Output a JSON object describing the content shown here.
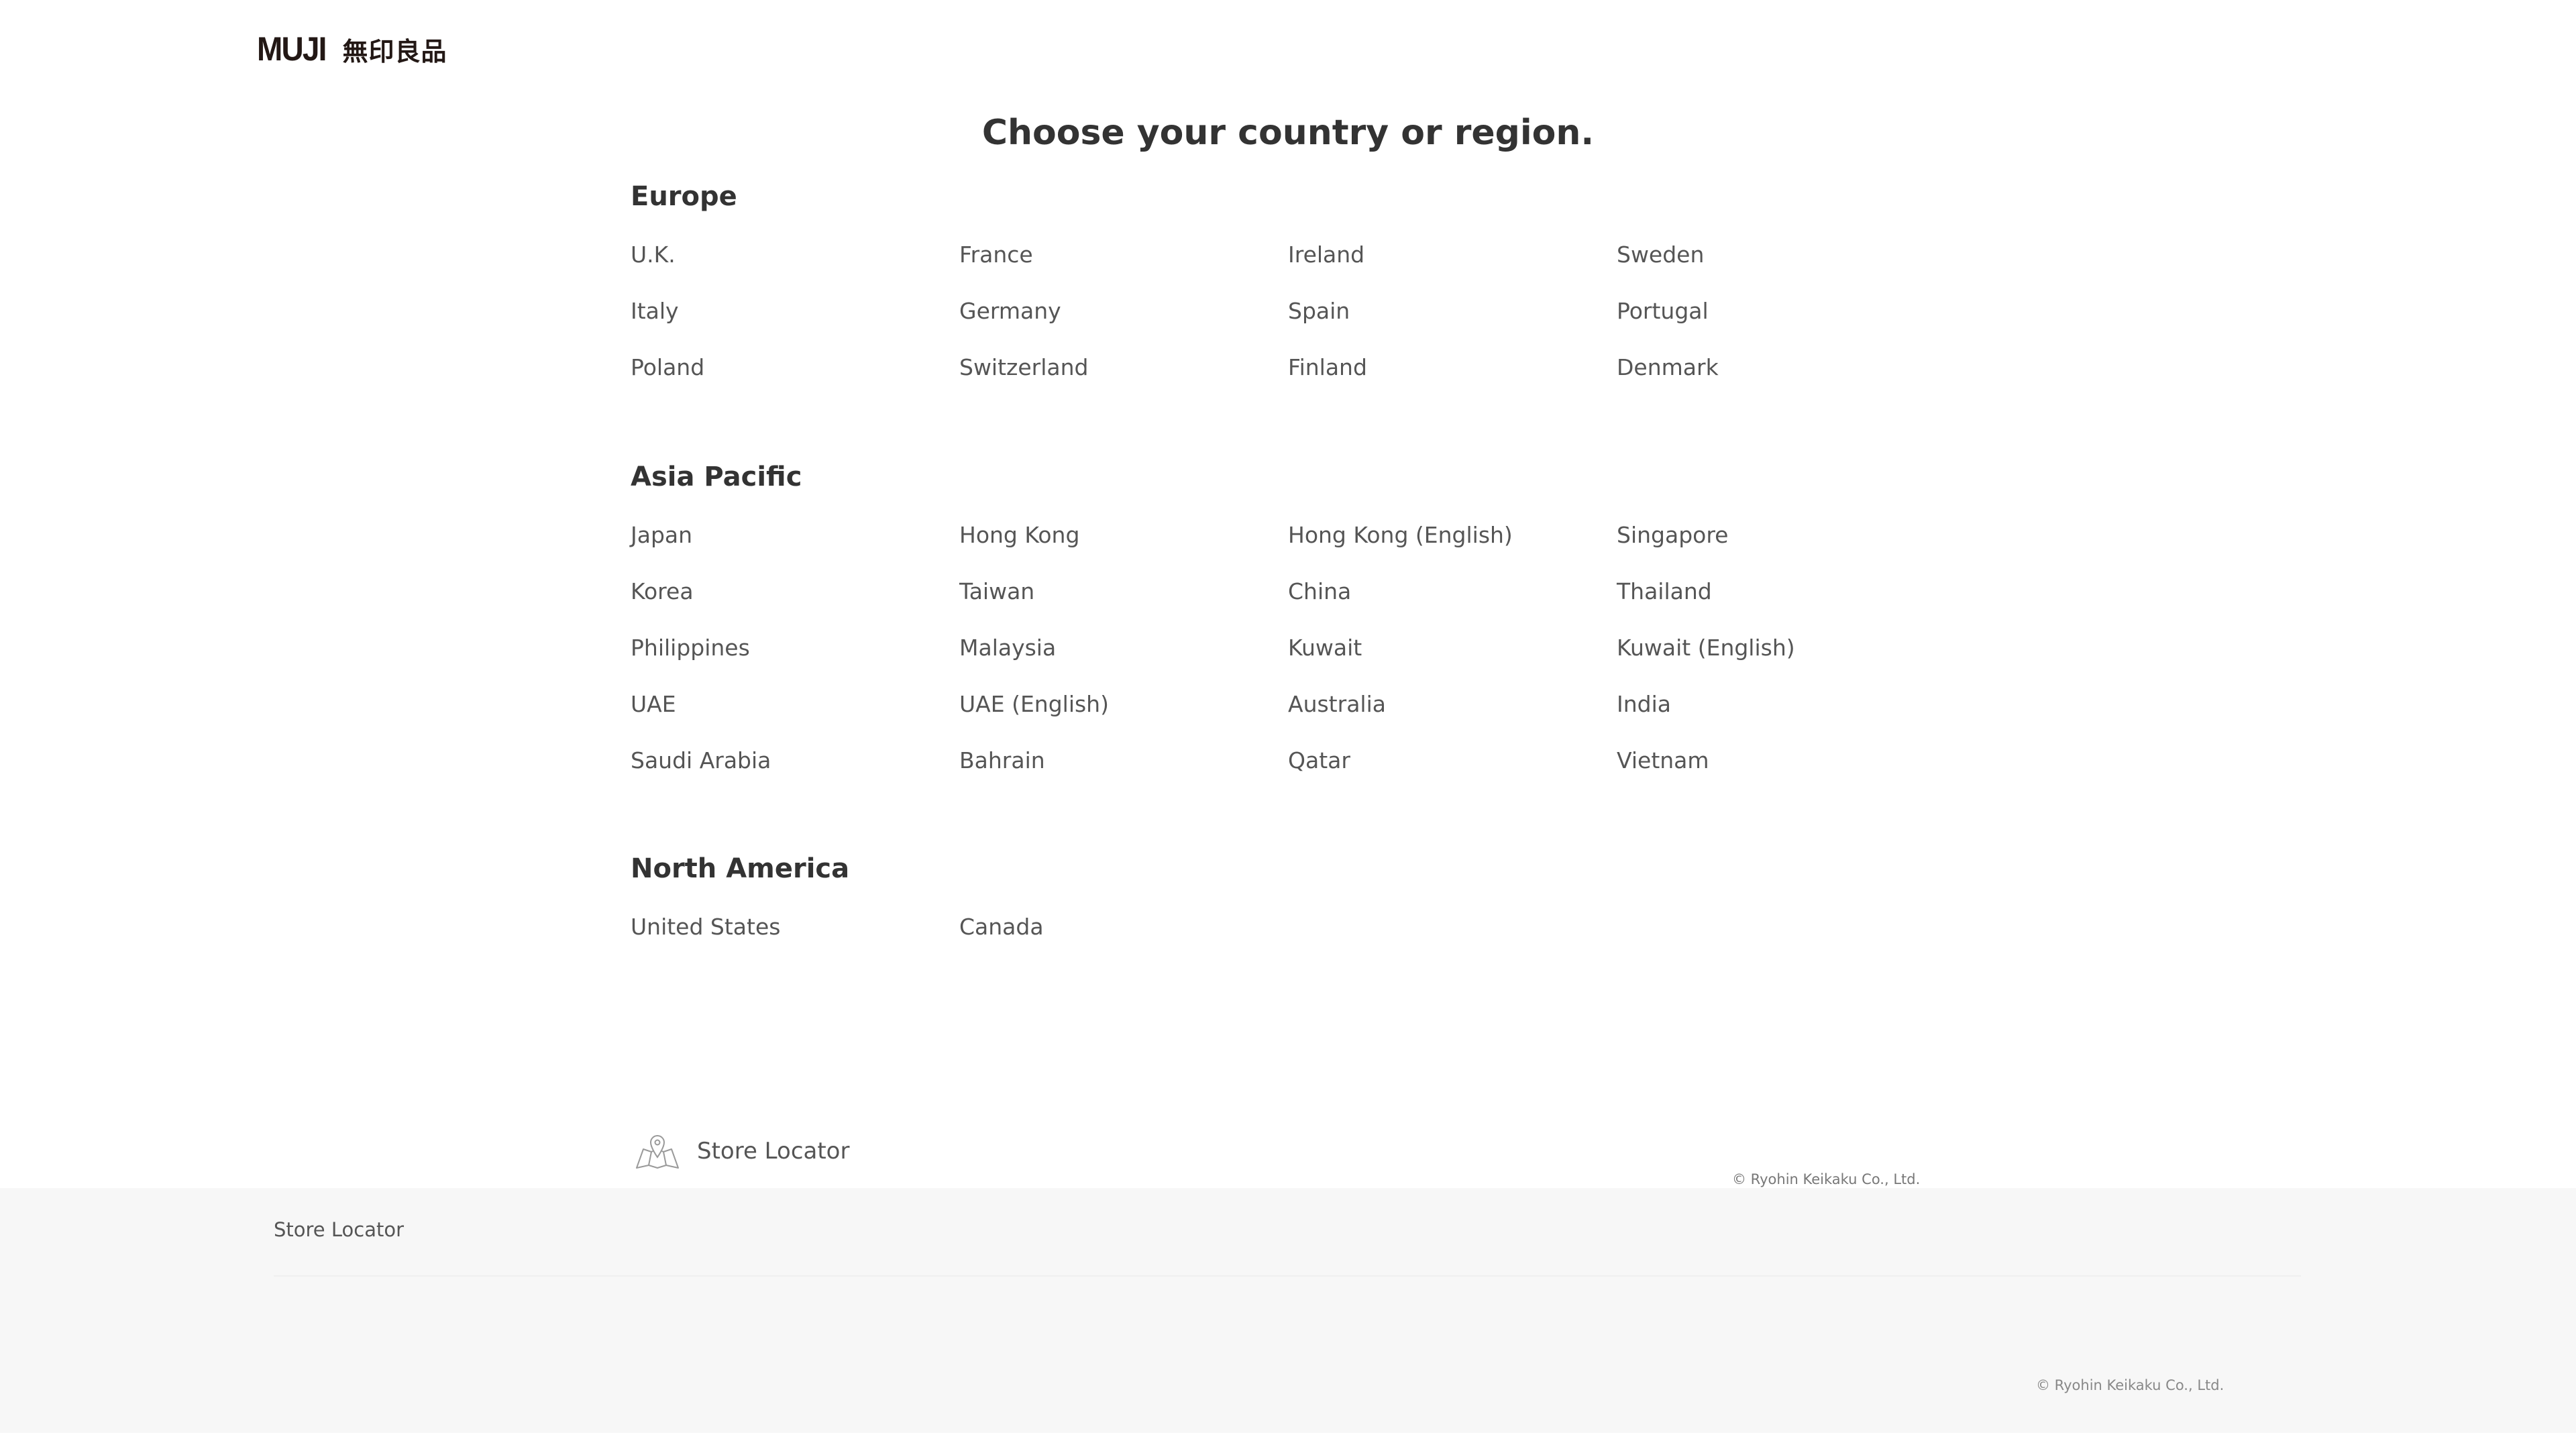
{
  "header": {
    "logo_text": "MUJI",
    "logo_kanji": "無印良品"
  },
  "main": {
    "title": "Choose your country or region.",
    "regions": [
      {
        "name": "Europe",
        "countries": [
          "U.K.",
          "France",
          "Ireland",
          "Sweden",
          "Italy",
          "Germany",
          "Spain",
          "Portugal",
          "Poland",
          "Switzerland",
          "Finland",
          "Denmark"
        ]
      },
      {
        "name": "Asia Pacific",
        "countries": [
          "Japan",
          "Hong Kong",
          "Hong Kong (English)",
          "Singapore",
          "Korea",
          "Taiwan",
          "China",
          "Thailand",
          "Philippines",
          "Malaysia",
          "Kuwait",
          "Kuwait (English)",
          "UAE",
          "UAE (English)",
          "Australia",
          "India",
          "Saudi Arabia",
          "Bahrain",
          "Qatar",
          "Vietnam"
        ]
      },
      {
        "name": "North America",
        "countries": [
          "United States",
          "Canada"
        ]
      }
    ],
    "store_locator_label": "Store Locator",
    "store_locator_icon": "map-pin-icon",
    "copyright": "© Ryohin Keikaku Co., Ltd."
  },
  "footer": {
    "store_locator_label": "Store Locator",
    "copyright": "© Ryohin Keikaku Co., Ltd."
  },
  "colors": {
    "text_primary": "#333333",
    "text_secondary": "#555555",
    "footer_bg": "#f7f7f7",
    "logo": "#231815"
  }
}
